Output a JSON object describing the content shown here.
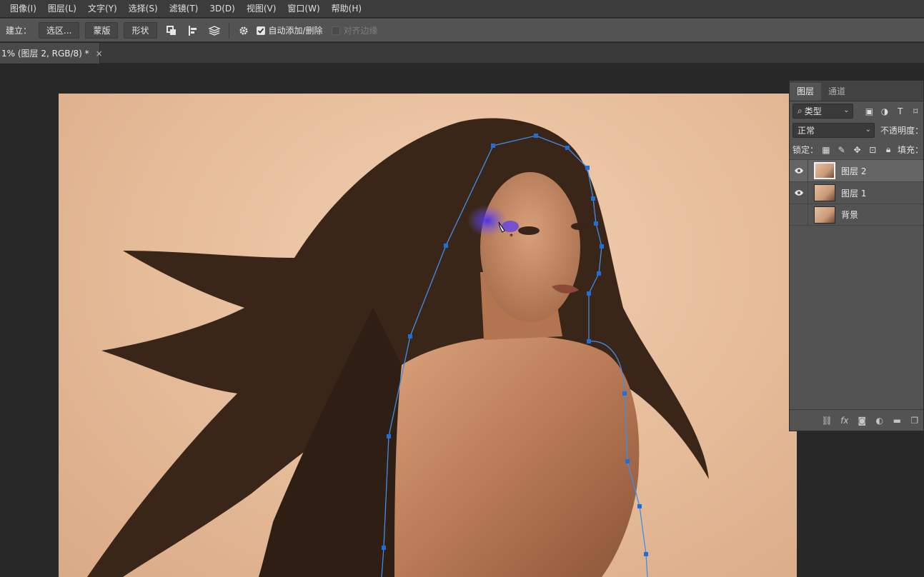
{
  "menu": [
    "图像(I)",
    "图层(L)",
    "文字(Y)",
    "选择(S)",
    "滤镜(T)",
    "3D(D)",
    "视图(V)",
    "窗口(W)",
    "帮助(H)"
  ],
  "options": {
    "make_label": "建立：",
    "selection_btn": "选区...",
    "mask_btn": "蒙版",
    "shape_btn": "形状",
    "auto_add_delete": "自动添加/删除",
    "align_edges": "对齐边缘",
    "auto_add_checked": true,
    "align_edges_checked": false
  },
  "document_tab": {
    "title": "1% (图层 2, RGB/8) *",
    "close": "×"
  },
  "layers_panel": {
    "tabs": [
      "图层",
      "通道"
    ],
    "filter_kind": "类型",
    "blend_mode": "正常",
    "opacity_label": "不透明度：",
    "lock_label": "锁定：",
    "fill_label": "填充：",
    "layers": [
      {
        "name": "图层 2",
        "visible": true,
        "selected": true
      },
      {
        "name": "图层 1",
        "visible": true,
        "selected": false
      },
      {
        "name": "背景",
        "visible": false,
        "selected": false
      }
    ],
    "footer_fx": "fx"
  },
  "colors": {
    "path_color": "#3d8fe6",
    "anchor_color": "#1f6fd6",
    "brush_color": "#5a3cf0",
    "canvas_bg": "#282828",
    "panel_bg": "#535353"
  }
}
